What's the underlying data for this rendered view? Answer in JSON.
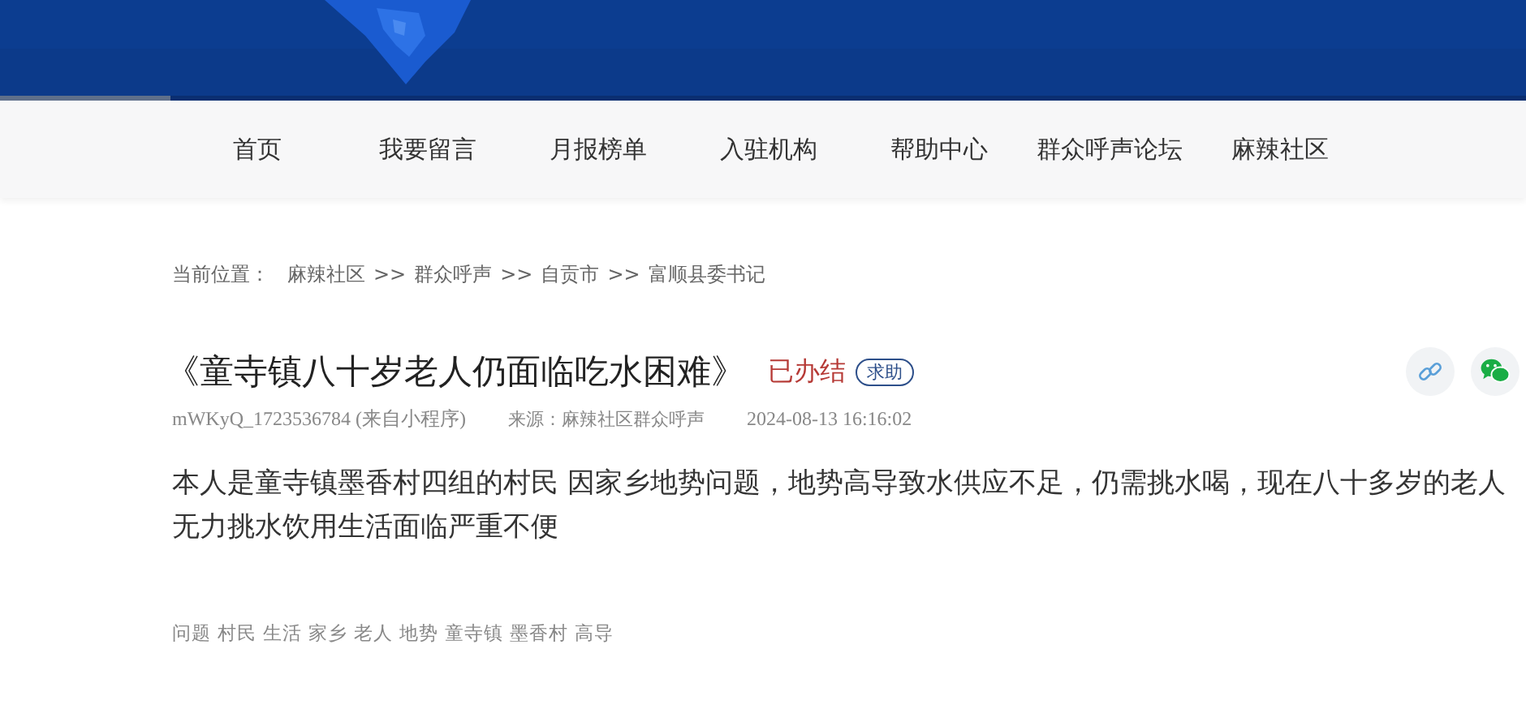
{
  "nav": {
    "items": [
      {
        "label": "首页"
      },
      {
        "label": "我要留言"
      },
      {
        "label": "月报榜单"
      },
      {
        "label": "入驻机构"
      },
      {
        "label": "帮助中心"
      },
      {
        "label": "群众呼声论坛"
      },
      {
        "label": "麻辣社区"
      }
    ]
  },
  "breadcrumb": {
    "label": "当前位置：",
    "items": [
      "麻辣社区",
      ">>",
      "群众呼声",
      ">>",
      "自贡市",
      ">>",
      "富顺县委书记"
    ]
  },
  "post": {
    "title": "《童寺镇八十岁老人仍面临吃水困难》",
    "status": {
      "text": "已办结",
      "kind": "done"
    },
    "tag": "求助",
    "author": "mWKyQ_1723536784 (来自小程序)",
    "source": "来源：麻辣社区群众呼声",
    "time": "2024-08-13 16:16:02",
    "body": "本人是童寺镇墨香村四组的村民 因家乡地势问题，地势高导致水供应不足，仍需挑水喝，现在八十多岁的老人无力挑水饮用生活面临严重不便",
    "keywords": [
      "问题",
      "村民",
      "生活",
      "家乡",
      "老人",
      "地势",
      "童寺镇",
      "墨香村",
      "高导"
    ]
  }
}
